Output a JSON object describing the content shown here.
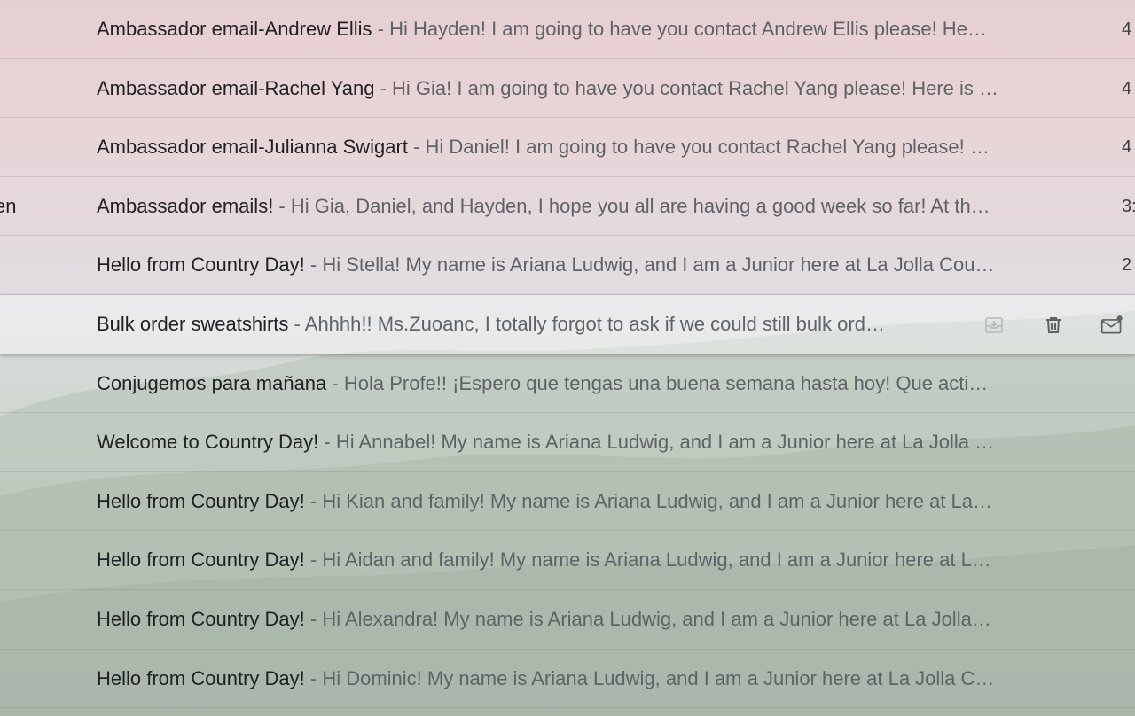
{
  "emails": [
    {
      "sender": "",
      "subject": "Ambassador email-Andrew Ellis",
      "separator": " - ",
      "snippet": "Hi Hayden! I am going to have you contact Andrew Ellis please! He…",
      "date": "4"
    },
    {
      "sender": "",
      "subject": "Ambassador email-Rachel Yang",
      "separator": " - ",
      "snippet": "Hi Gia! I am going to have you contact Rachel Yang please! Here is …",
      "date": "4"
    },
    {
      "sender": "",
      "subject": "Ambassador email-Julianna Swigart",
      "separator": " - ",
      "snippet": "Hi Daniel! I am going to have you contact Rachel Yang please! …",
      "date": "4"
    },
    {
      "sender": "en",
      "subject": "Ambassador emails!",
      "separator": " - ",
      "snippet": "Hi Gia, Daniel, and Hayden, I hope you all are having a good week so far! At th…",
      "date": "3:"
    },
    {
      "sender": "",
      "subject": "Hello from Country Day!",
      "separator": " - ",
      "snippet": "Hi Stella! My name is Ariana Ludwig, and I am a Junior here at La Jolla Cou…",
      "date": "2"
    },
    {
      "sender": "",
      "subject": "Bulk order sweatshirts",
      "separator": " - ",
      "snippet": "Ahhhh!! Ms.Zuoanc, I totally forgot to ask if we could still bulk ord…",
      "date": ""
    },
    {
      "sender": "",
      "subject": "Conjugemos para mañana",
      "separator": " - ",
      "snippet": "Hola Profe!! ¡Espero que tengas una buena semana hasta hoy! Que acti…",
      "date": ""
    },
    {
      "sender": "",
      "subject": "Welcome to Country Day!",
      "separator": " - ",
      "snippet": "Hi Annabel! My name is Ariana Ludwig, and I am a Junior here at La Jolla …",
      "date": ""
    },
    {
      "sender": "",
      "subject": "Hello from Country Day!",
      "separator": " - ",
      "snippet": "Hi Kian and family! My name is Ariana Ludwig, and I am a Junior here at La…",
      "date": ""
    },
    {
      "sender": "",
      "subject": "Hello from Country Day!",
      "separator": " - ",
      "snippet": "Hi Aidan and family! My name is Ariana Ludwig, and I am a Junior here at L…",
      "date": ""
    },
    {
      "sender": "",
      "subject": "Hello from Country Day!",
      "separator": " - ",
      "snippet": "Hi Alexandra! My name is Ariana Ludwig, and I am a Junior here at La Jolla…",
      "date": ""
    },
    {
      "sender": "",
      "subject": "Hello from Country Day!",
      "separator": " - ",
      "snippet": "Hi Dominic! My name is Ariana Ludwig, and I am a Junior here at La Jolla C…",
      "date": ""
    }
  ],
  "hovered_row": 5,
  "hover_actions": [
    {
      "icon": "archive-icon"
    },
    {
      "icon": "trash-icon"
    },
    {
      "icon": "mark-unread-icon"
    }
  ],
  "colors": {
    "subject": "#202124",
    "snippet": "#5f6368",
    "icon": "#5f6368"
  }
}
